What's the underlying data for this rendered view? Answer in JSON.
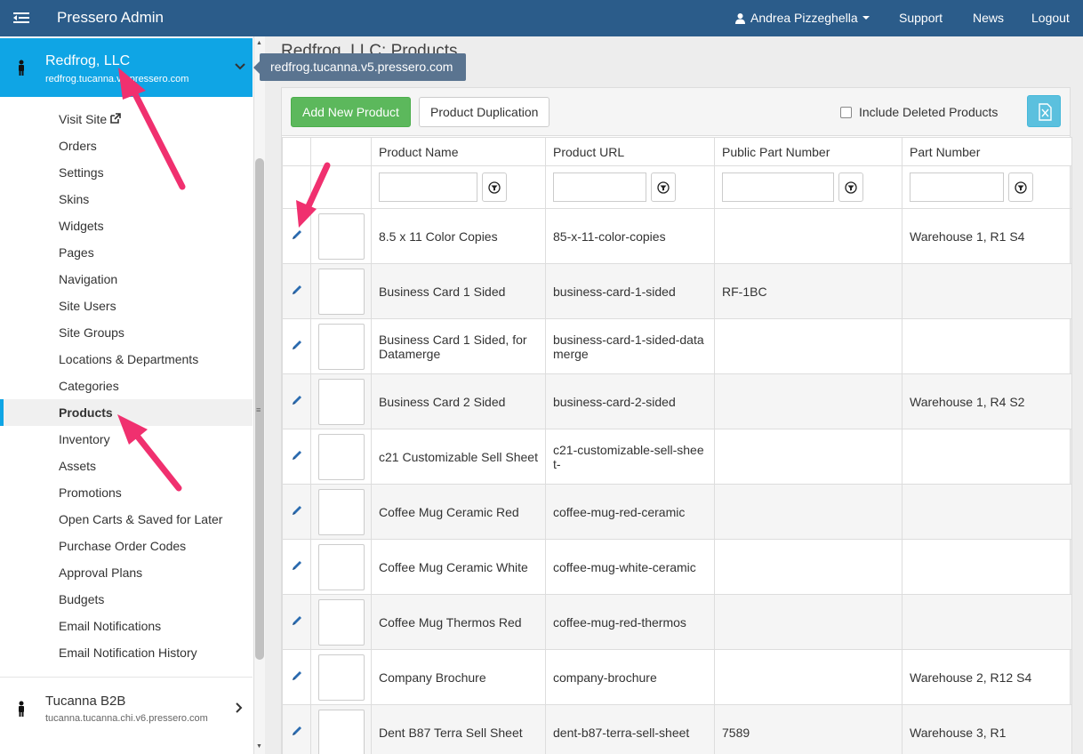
{
  "topbar": {
    "title": "Pressero Admin",
    "user": "Andrea Pizzeghella",
    "links": [
      "Support",
      "News",
      "Logout"
    ]
  },
  "sidebar": {
    "current_site": {
      "name": "Redfrog, LLC",
      "url": "redfrog.tucanna.v5.pressero.com"
    },
    "items": [
      "Visit Site",
      "Orders",
      "Settings",
      "Skins",
      "Widgets",
      "Pages",
      "Navigation",
      "Site Users",
      "Site Groups",
      "Locations & Departments",
      "Categories",
      "Products",
      "Inventory",
      "Assets",
      "Promotions",
      "Open Carts & Saved for Later",
      "Purchase Order Codes",
      "Approval Plans",
      "Budgets",
      "Email Notifications",
      "Email Notification History"
    ],
    "active_item": "Products",
    "other_site": {
      "name": "Tucanna B2B",
      "url": "tucanna.tucanna.chi.v6.pressero.com"
    }
  },
  "tooltip": "redfrog.tucanna.v5.pressero.com",
  "main": {
    "title": "Redfrog, LLC: Products",
    "add_button": "Add New Product",
    "dup_button": "Product Duplication",
    "include_deleted": "Include Deleted Products",
    "columns": [
      "Product Name",
      "Product URL",
      "Public Part Number",
      "Part Number"
    ],
    "rows": [
      {
        "name": "8.5 x 11 Color Copies",
        "url": "85-x-11-color-copies",
        "public_part": "",
        "part": "Warehouse 1, R1 S4"
      },
      {
        "name": "Business Card 1 Sided",
        "url": "business-card-1-sided",
        "public_part": "RF-1BC",
        "part": ""
      },
      {
        "name": "Business Card 1 Sided, for Datamerge",
        "url": "business-card-1-sided-datamerge",
        "public_part": "",
        "part": ""
      },
      {
        "name": "Business Card 2 Sided",
        "url": "business-card-2-sided",
        "public_part": "",
        "part": "Warehouse 1, R4 S2"
      },
      {
        "name": "c21 Customizable Sell Sheet",
        "url": "c21-customizable-sell-sheet-",
        "public_part": "",
        "part": ""
      },
      {
        "name": "Coffee Mug Ceramic Red",
        "url": "coffee-mug-red-ceramic",
        "public_part": "",
        "part": ""
      },
      {
        "name": "Coffee Mug Ceramic White",
        "url": "coffee-mug-white-ceramic",
        "public_part": "",
        "part": ""
      },
      {
        "name": "Coffee Mug Thermos Red",
        "url": "coffee-mug-red-thermos",
        "public_part": "",
        "part": ""
      },
      {
        "name": "Company Brochure",
        "url": "company-brochure",
        "public_part": "",
        "part": "Warehouse 2, R12 S4"
      },
      {
        "name": "Dent B87 Terra Sell Sheet",
        "url": "dent-b87-terra-sell-sheet",
        "public_part": "7589",
        "part": "Warehouse 3, R1"
      }
    ]
  },
  "colors": {
    "topbar": "#2b5c8a",
    "accent": "#0fa5e5",
    "success": "#5cb85c",
    "annotation_arrow": "#f0306f"
  }
}
